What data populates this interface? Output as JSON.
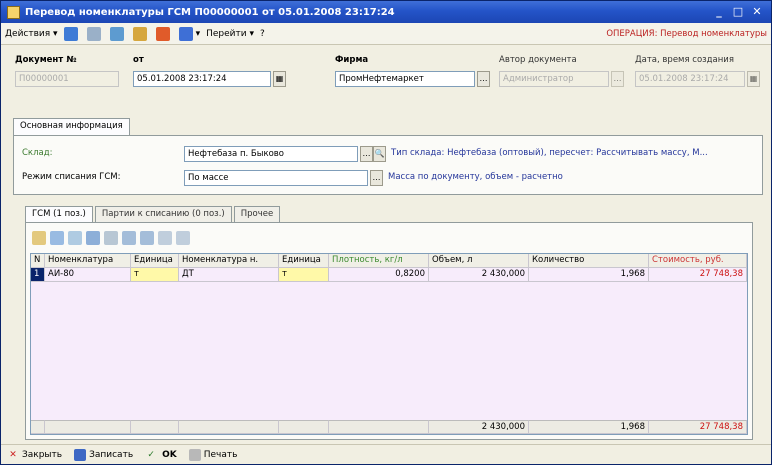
{
  "window": {
    "title": "Перевод номенклатуры ГСМ П00000001 от 05.01.2008 23:17:24"
  },
  "toolbar": {
    "actions_label": "Действия",
    "print_label": "Перейти",
    "help_label": "?",
    "operation_label": "ОПЕРАЦИЯ: Перевод номенклатуры"
  },
  "header": {
    "doc_number_label": "Документ №",
    "doc_number_value": "П00000001",
    "from_label": "от",
    "from_value": "05.01.2008 23:17:24",
    "company_label": "Фирма",
    "company_value": "ПромНефтемаркет",
    "author_label": "Автор документа",
    "author_value": "Администратор",
    "created_label": "Дата, время создания",
    "created_value": "05.01.2008 23:17:24"
  },
  "tabs_main": [
    {
      "label": "Основная информация"
    }
  ],
  "main": {
    "warehouse_label": "Склад:",
    "warehouse_value": "Нефтебаза п. Быково",
    "warehouse_type_text": "Тип склада: Нефтебаза (оптовый), пересчет: Рассчитывать массу, М...",
    "mode_label": "Режим списания ГСМ:",
    "mode_value": "По массе",
    "mode_hint": "Масса по документу, объем - расчетно"
  },
  "tabs_inner": [
    {
      "label": "ГСМ (1 поз.)"
    },
    {
      "label": "Партии к списанию (0 поз.)"
    },
    {
      "label": "Прочее"
    }
  ],
  "grid": {
    "columns": [
      "N",
      "Номенклатура",
      "Единица",
      "Номенклатура н.",
      "Единица",
      "Плотность, кг/л",
      "Объем, л",
      "Количество",
      "Стоимость, руб."
    ],
    "rows": [
      [
        "1",
        "АИ-80",
        "т",
        "ДТ",
        "т",
        "0,8200",
        "2 430,000",
        "1,968",
        "27 748,38"
      ]
    ],
    "totals": {
      "volume": "2 430,000",
      "quantity": "1,968",
      "cost": "27 748,38"
    }
  },
  "bottom": {
    "close_label": "Закрыть",
    "save_label": "Записать",
    "ok_label": "OK",
    "print_label": "Печать"
  }
}
